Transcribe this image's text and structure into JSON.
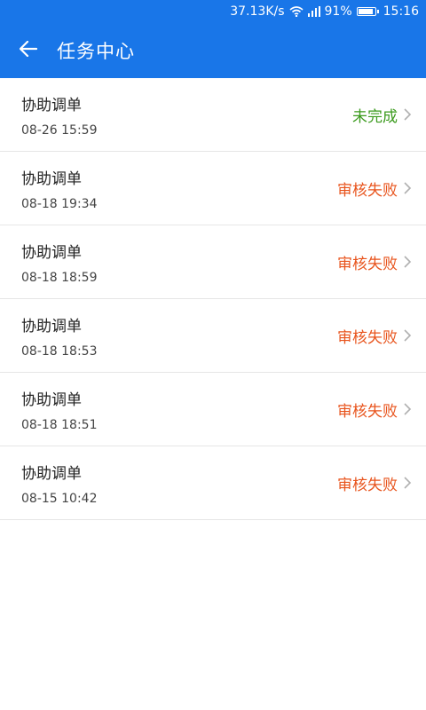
{
  "status_bar": {
    "speed": "37.13K/s",
    "battery_pct": "91%",
    "battery_level": 0.91,
    "time": "15:16"
  },
  "header": {
    "title": "任务中心",
    "icon": "back-arrow-icon"
  },
  "colors": {
    "primary": "#1976e8",
    "status_incomplete": "#3a9a1c",
    "status_failed": "#e8541d",
    "divider": "#e6e6e6"
  },
  "tasks": [
    {
      "name": "协助调单",
      "time": "08-26 15:59",
      "status": "未完成",
      "status_color": "#3a9a1c"
    },
    {
      "name": "协助调单",
      "time": "08-18 19:34",
      "status": "审核失败",
      "status_color": "#e8541d"
    },
    {
      "name": "协助调单",
      "time": "08-18 18:59",
      "status": "审核失败",
      "status_color": "#e8541d"
    },
    {
      "name": "协助调单",
      "time": "08-18 18:53",
      "status": "审核失败",
      "status_color": "#e8541d"
    },
    {
      "name": "协助调单",
      "time": "08-18 18:51",
      "status": "审核失败",
      "status_color": "#e8541d"
    },
    {
      "name": "协助调单",
      "time": "08-15 10:42",
      "status": "审核失败",
      "status_color": "#e8541d"
    }
  ]
}
